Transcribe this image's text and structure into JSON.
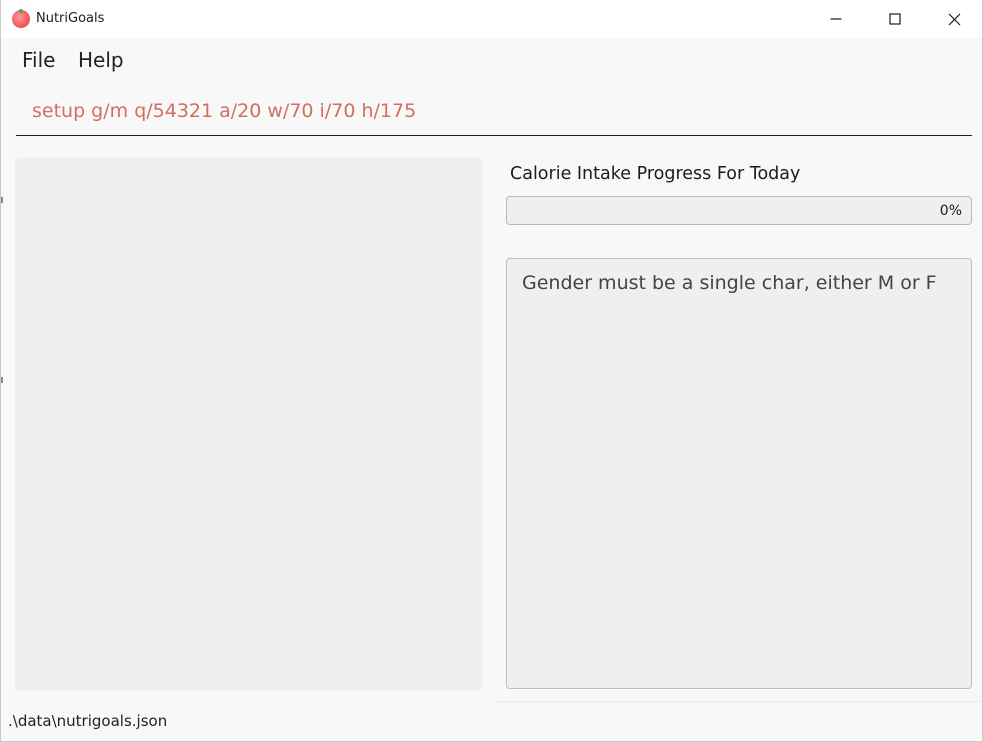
{
  "window": {
    "title": "NutriGoals",
    "app_icon": "tomato-icon",
    "controls": {
      "minimize_icon": "minimize-icon",
      "maximize_icon": "maximize-icon",
      "close_icon": "close-icon"
    }
  },
  "menubar": {
    "file_label": "File",
    "help_label": "Help"
  },
  "command": {
    "value": "setup g/m q/54321 a/20 w/70 i/70 h/175",
    "text_color": "#d07060"
  },
  "progress": {
    "label": "Calorie Intake Progress For Today",
    "percent_text": "0%",
    "value": 0
  },
  "result": {
    "message": "Gender must be a single char, either M or F"
  },
  "status": {
    "file_path": ".\\data\\nutrigoals.json"
  }
}
